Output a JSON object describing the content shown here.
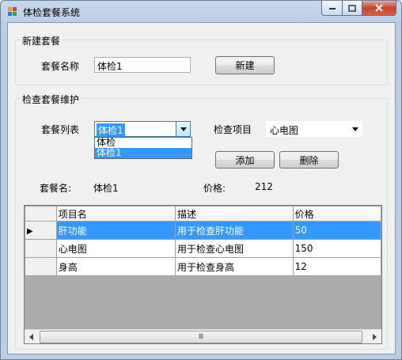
{
  "window": {
    "title": "体检套餐系统",
    "accent": "#3399ff"
  },
  "new_group": {
    "title": "新建套餐",
    "name_label": "套餐名称",
    "name_value": "体检1",
    "create_button": "新建"
  },
  "maint_group": {
    "title": "检查套餐维护",
    "package_list_label": "套餐列表",
    "package_selected": "体检1",
    "package_options": [
      "体检",
      "体检1"
    ],
    "package_options_selected": 1,
    "item_label": "检查项目",
    "item_selected": "心电图",
    "add_button": "添加",
    "delete_button": "删除",
    "pkg_name_label": "套餐名:",
    "pkg_name_value": "体检1",
    "price_label": "价格:",
    "price_value": "212"
  },
  "grid": {
    "columns": [
      "项目名",
      "描述",
      "价格"
    ],
    "rows": [
      {
        "name": "肝功能",
        "desc": "用于检查肝功能",
        "price": "50",
        "selected": true
      },
      {
        "name": "心电图",
        "desc": "用于检查心电图",
        "price": "150",
        "selected": false
      },
      {
        "name": "身高",
        "desc": "用于检查身高",
        "price": "12",
        "selected": false
      }
    ],
    "selected_row_marker": "▶",
    "thumb_grip": "Ⅲ"
  }
}
